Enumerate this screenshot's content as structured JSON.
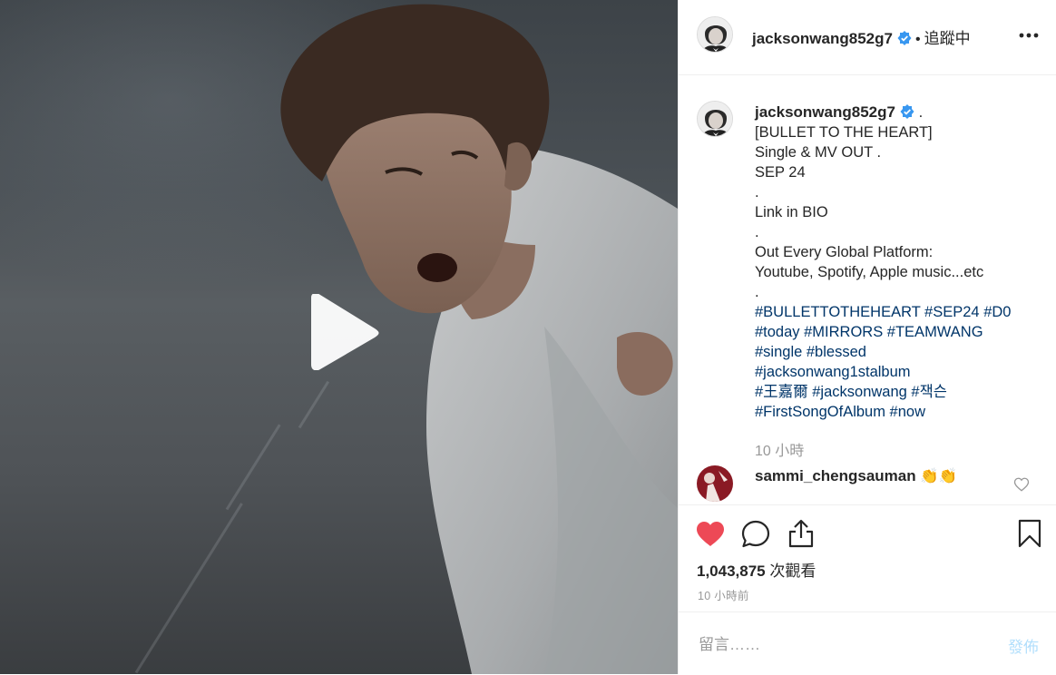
{
  "post": {
    "username": "jacksonwang852g7",
    "follow_dot": "•",
    "follow_status": "追蹤中",
    "caption_suffix": ".",
    "caption_lines": [
      "[BULLET TO THE HEART]",
      "Single & MV OUT .",
      "SEP 24",
      ".",
      "Link in BIO",
      ".",
      "Out Every Global Platform:",
      "Youtube, Spotify, Apple music...etc",
      "."
    ],
    "hashtag_lines": [
      "#BULLETTOTHEHEART #SEP24 #D0",
      "#today #MIRRORS #TEAMWANG",
      "#single #blessed",
      "#jacksonwang1stalbum",
      "#王嘉爾 #jacksonwang #잭슨",
      "#FirstSongOfAlbum #now"
    ],
    "caption_time": "10 小時",
    "comment": {
      "username": "sammi_chengsauman",
      "text": "👏👏"
    },
    "views_count": "1,043,875",
    "views_label": "次觀看",
    "posted_time": "10 小時前"
  },
  "add_comment": {
    "placeholder": "留言……",
    "post_label": "發佈"
  },
  "colors": {
    "like_red": "#ed4956",
    "verified_blue": "#3897f0",
    "hashtag_blue": "#003569",
    "muted_grey": "#999999",
    "post_disabled": "#b2dffc"
  },
  "icons": {
    "play": "play-icon",
    "verified": "verified-badge-icon",
    "more": "more-options-icon",
    "like": "heart-filled-icon",
    "comment": "comment-icon",
    "share": "share-icon",
    "save": "bookmark-icon",
    "comment_like": "heart-outline-icon"
  }
}
